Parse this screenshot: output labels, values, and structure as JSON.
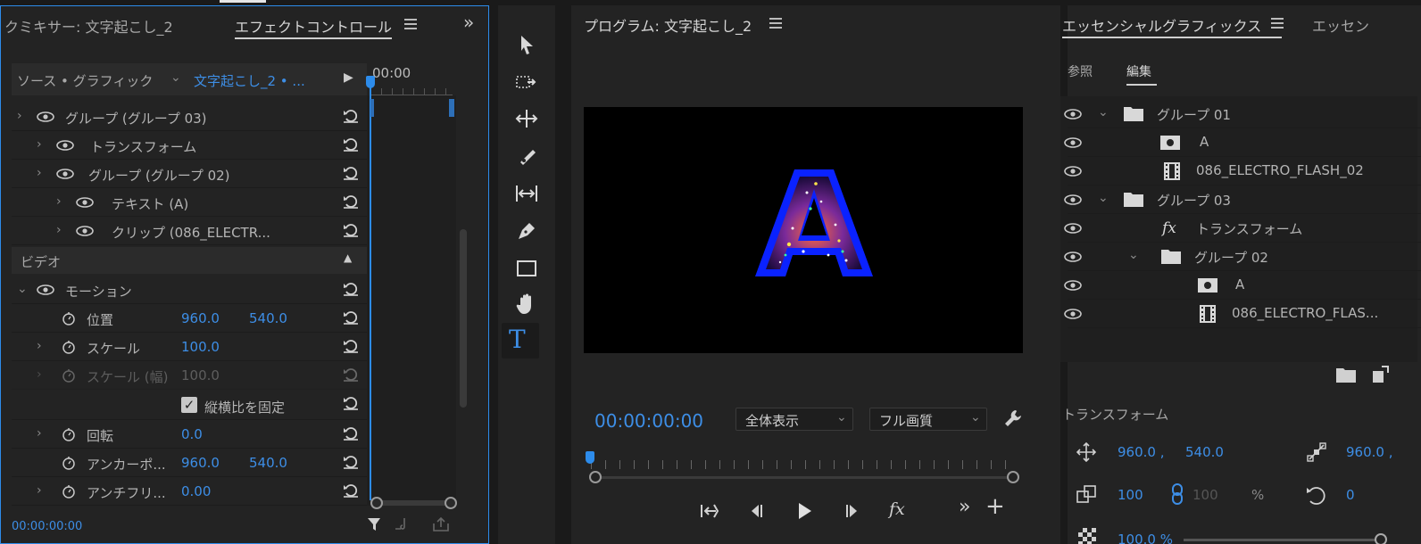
{
  "effect_controls": {
    "tab_mixer": "クミキサー: 文字起こし_2",
    "tab_effects": "エフェクトコントロール",
    "source_label": "ソース • グラフィック",
    "clip_name": "文字起こし_2 • ...",
    "timeline_time": "00:00",
    "layers": [
      {
        "label": "グループ (グループ 03)"
      },
      {
        "label": "トランスフォーム"
      },
      {
        "label": "グループ (グループ 02)"
      },
      {
        "label": "テキスト (A)"
      },
      {
        "label": "クリップ (086_ELECTR..."
      }
    ],
    "section_video": "ビデオ",
    "motion": "モーション",
    "props": {
      "position": {
        "label": "位置",
        "x": "960.0",
        "y": "540.0"
      },
      "scale": {
        "label": "スケール",
        "value": "100.0"
      },
      "scale_width": {
        "label": "スケール (幅)",
        "value": "100.0"
      },
      "uniform": {
        "label": "縦横比を固定",
        "checked": true
      },
      "rotation": {
        "label": "回転",
        "value": "0.0"
      },
      "anchor": {
        "label": "アンカーポ...",
        "x": "960.0",
        "y": "540.0"
      },
      "antiflicker": {
        "label": "アンチフリ...",
        "value": "0.00"
      }
    },
    "footer_time": "00:00:00:00"
  },
  "program": {
    "title": "プログラム: 文字起こし_2",
    "timecode": "00:00:00:00",
    "zoom": "全体表示",
    "quality": "フル画質",
    "preview_letter": "A"
  },
  "essential_graphics": {
    "tab_main": "エッセンシャルグラフィックス",
    "tab_second": "エッセン",
    "subtab_browse": "参照",
    "subtab_edit": "編集",
    "layers": [
      {
        "label": "グループ 01",
        "type": "folder"
      },
      {
        "label": "A",
        "type": "text"
      },
      {
        "label": "086_ELECTRO_FLASH_02",
        "type": "clip"
      },
      {
        "label": "グループ 03",
        "type": "folder"
      },
      {
        "label": "トランスフォーム",
        "type": "fx"
      },
      {
        "label": "グループ 02",
        "type": "folder"
      },
      {
        "label": "A",
        "type": "text"
      },
      {
        "label": "086_ELECTRO_FLAS...",
        "type": "clip"
      }
    ],
    "transform_title": "トランスフォーム",
    "pos_x": "960.0 ,",
    "pos_y": "540.0",
    "anchor_x": "960.0 ,",
    "scale": "100",
    "scale_w": "100",
    "percent": "%",
    "rotation": "0",
    "opacity": "100.0 %"
  }
}
